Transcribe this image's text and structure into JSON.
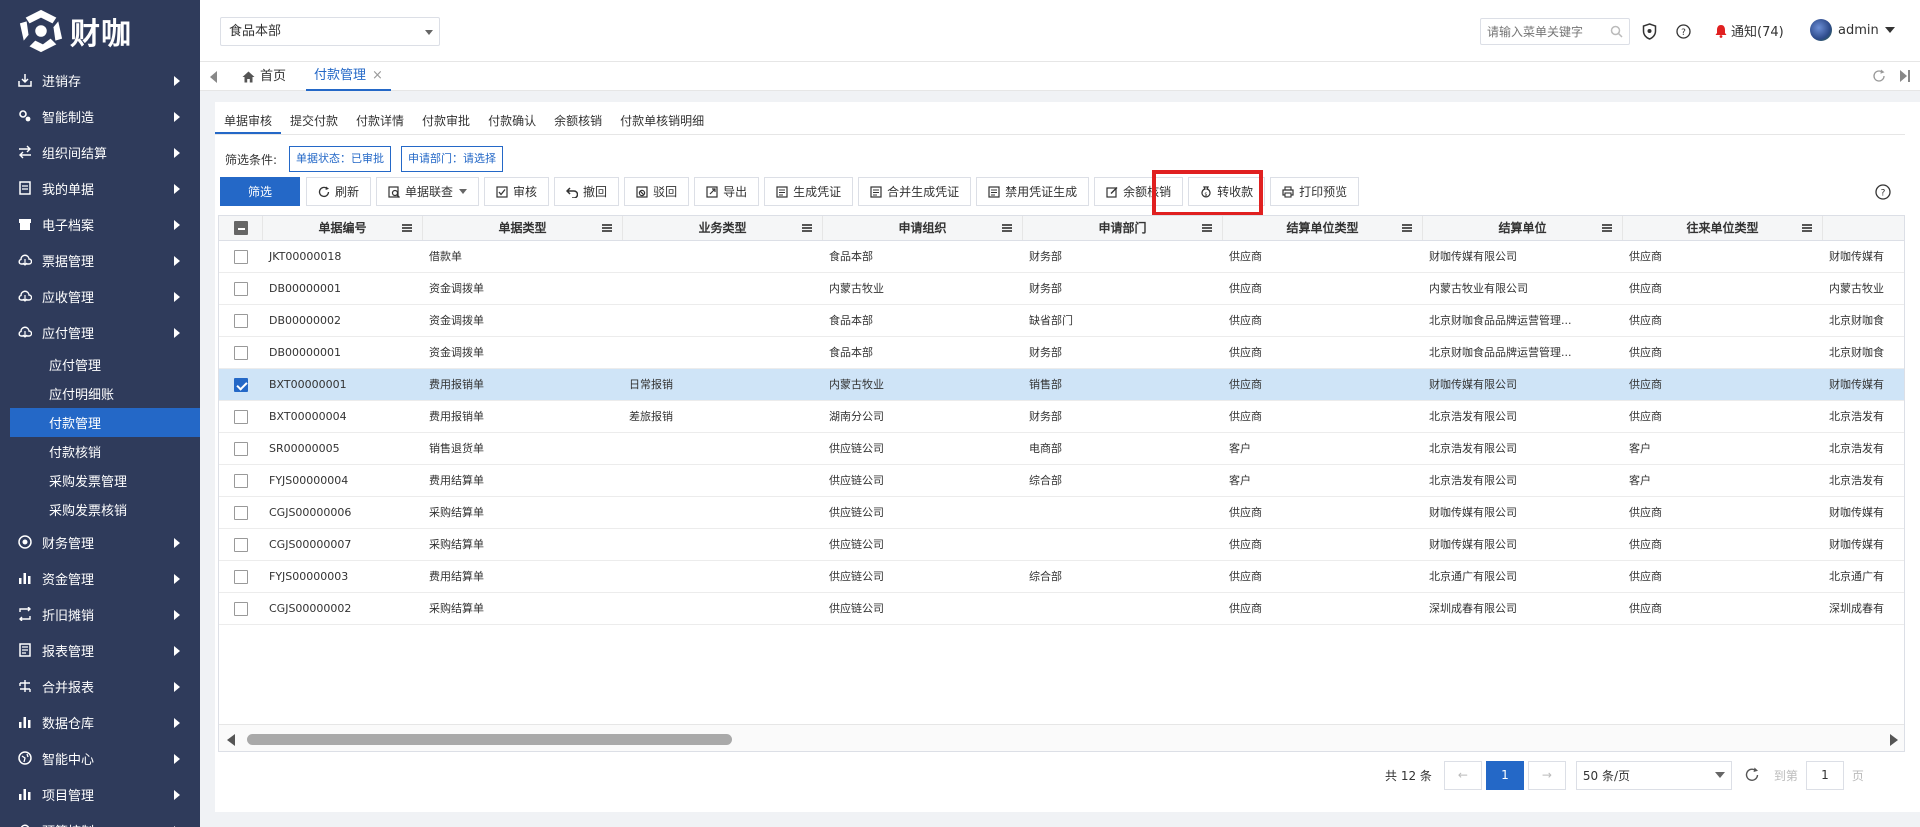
{
  "app": {
    "logo_text": "财咖"
  },
  "header": {
    "org_select": "食品本部",
    "search_placeholder": "请输入菜单关键字",
    "notice": "通知(74)",
    "user": "admin"
  },
  "sidebar": {
    "items": [
      {
        "label": "进销存",
        "icon": "inventory-icon"
      },
      {
        "label": "智能制造",
        "icon": "gears-icon"
      },
      {
        "label": "组织间结算",
        "icon": "transfer-icon"
      },
      {
        "label": "我的单据",
        "icon": "document-icon"
      },
      {
        "label": "电子档案",
        "icon": "archive-icon"
      },
      {
        "label": "票据管理",
        "icon": "cloud-icon"
      },
      {
        "label": "应收管理",
        "icon": "cloud-icon"
      },
      {
        "label": "应付管理",
        "icon": "cloud-icon"
      }
    ],
    "subitems": [
      {
        "label": "应付管理",
        "active": false
      },
      {
        "label": "应付明细账",
        "active": false
      },
      {
        "label": "付款管理",
        "active": true
      },
      {
        "label": "付款核销",
        "active": false
      },
      {
        "label": "采购发票管理",
        "active": false
      },
      {
        "label": "采购发票核销",
        "active": false
      }
    ],
    "items_after": [
      {
        "label": "财务管理",
        "icon": "finance-icon"
      },
      {
        "label": "资金管理",
        "icon": "bar-chart-icon"
      },
      {
        "label": "折旧摊销",
        "icon": "cycle-icon"
      },
      {
        "label": "报表管理",
        "icon": "report-icon"
      },
      {
        "label": "合并报表",
        "icon": "merge-icon"
      },
      {
        "label": "数据仓库",
        "icon": "bar-chart-icon"
      },
      {
        "label": "智能中心",
        "icon": "globe-icon"
      },
      {
        "label": "项目管理",
        "icon": "bar-chart-icon"
      },
      {
        "label": "预算控制",
        "icon": "cloud-icon"
      }
    ]
  },
  "tabs": {
    "home": "首页",
    "current": "付款管理"
  },
  "subtabs": [
    "单据审核",
    "提交付款",
    "付款详情",
    "付款审批",
    "付款确认",
    "余额核销",
    "付款单核销明细"
  ],
  "filters": {
    "label": "筛选条件:",
    "chips": [
      "单据状态：已审批",
      "申请部门：请选择"
    ]
  },
  "toolbar": {
    "filter": "筛选",
    "buttons": [
      {
        "label": "刷新",
        "icon": "refresh-icon"
      },
      {
        "label": "单据联查",
        "icon": "search-doc-icon",
        "dropdown": true
      },
      {
        "label": "审核",
        "icon": "check-icon"
      },
      {
        "label": "撤回",
        "icon": "undo-icon"
      },
      {
        "label": "驳回",
        "icon": "reject-icon"
      },
      {
        "label": "导出",
        "icon": "export-icon"
      },
      {
        "label": "生成凭证",
        "icon": "voucher-icon"
      },
      {
        "label": "合并生成凭证",
        "icon": "voucher-icon"
      },
      {
        "label": "禁用凭证生成",
        "icon": "voucher-icon"
      },
      {
        "label": "余额核销",
        "icon": "edit-icon"
      },
      {
        "label": "转收款",
        "icon": "money-bag-icon"
      },
      {
        "label": "打印预览",
        "icon": "print-icon"
      }
    ]
  },
  "table": {
    "columns": [
      "单据编号",
      "单据类型",
      "业务类型",
      "申请组织",
      "申请部门",
      "结算单位类型",
      "结算单位",
      "往来单位类型",
      "往"
    ],
    "rows": [
      {
        "checked": false,
        "cells": [
          "JKT00000018",
          "借款单",
          "",
          "食品本部",
          "财务部",
          "供应商",
          "财咖传媒有限公司",
          "供应商",
          "财咖传媒有"
        ]
      },
      {
        "checked": false,
        "cells": [
          "DB00000001",
          "资金调拨单",
          "",
          "内蒙古牧业",
          "财务部",
          "供应商",
          "内蒙古牧业有限公司",
          "供应商",
          "内蒙古牧业"
        ]
      },
      {
        "checked": false,
        "cells": [
          "DB00000002",
          "资金调拨单",
          "",
          "食品本部",
          "缺省部门",
          "供应商",
          "北京财咖食品品牌运营管理...",
          "供应商",
          "北京财咖食"
        ]
      },
      {
        "checked": false,
        "cells": [
          "DB00000001",
          "资金调拨单",
          "",
          "食品本部",
          "财务部",
          "供应商",
          "北京财咖食品品牌运营管理...",
          "供应商",
          "北京财咖食"
        ]
      },
      {
        "checked": true,
        "cells": [
          "BXT00000001",
          "费用报销单",
          "日常报销",
          "内蒙古牧业",
          "销售部",
          "供应商",
          "财咖传媒有限公司",
          "供应商",
          "财咖传媒有"
        ]
      },
      {
        "checked": false,
        "cells": [
          "BXT00000004",
          "费用报销单",
          "差旅报销",
          "湖南分公司",
          "财务部",
          "供应商",
          "北京浩发有限公司",
          "供应商",
          "北京浩发有"
        ]
      },
      {
        "checked": false,
        "cells": [
          "SR00000005",
          "销售退货单",
          "",
          "供应链公司",
          "电商部",
          "客户",
          "北京浩发有限公司",
          "客户",
          "北京浩发有"
        ]
      },
      {
        "checked": false,
        "cells": [
          "FYJS00000004",
          "费用结算单",
          "",
          "供应链公司",
          "综合部",
          "客户",
          "北京浩发有限公司",
          "客户",
          "北京浩发有"
        ]
      },
      {
        "checked": false,
        "cells": [
          "CGJS00000006",
          "采购结算单",
          "",
          "供应链公司",
          "",
          "供应商",
          "财咖传媒有限公司",
          "供应商",
          "财咖传媒有"
        ]
      },
      {
        "checked": false,
        "cells": [
          "CGJS00000007",
          "采购结算单",
          "",
          "供应链公司",
          "",
          "供应商",
          "财咖传媒有限公司",
          "供应商",
          "财咖传媒有"
        ]
      },
      {
        "checked": false,
        "cells": [
          "FYJS00000003",
          "费用结算单",
          "",
          "供应链公司",
          "综合部",
          "供应商",
          "北京通广有限公司",
          "供应商",
          "北京通广有"
        ]
      },
      {
        "checked": false,
        "cells": [
          "CGJS00000002",
          "采购结算单",
          "",
          "供应链公司",
          "",
          "供应商",
          "深圳成春有限公司",
          "供应商",
          "深圳成春有"
        ]
      }
    ]
  },
  "pager": {
    "total": "共 12 条",
    "prev": "←",
    "page": "1",
    "next": "→",
    "page_size": "50 条/页",
    "goto_label": "到第",
    "goto_value": "1",
    "page_unit": "页"
  },
  "colors": {
    "sidebar_bg": "#2f3b5b",
    "accent": "#2468c7",
    "highlight": "#e02020",
    "selected_row": "#cfe4f7"
  }
}
